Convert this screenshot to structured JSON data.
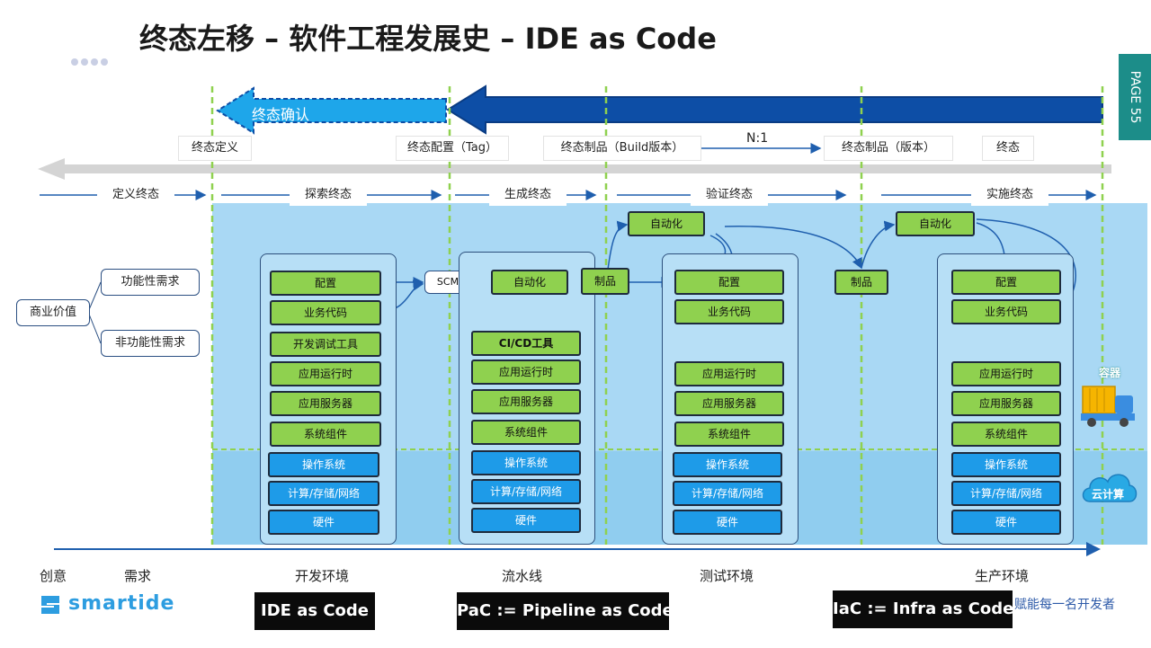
{
  "title": "终态左移 – 软件工程发展史 – IDE as Code",
  "page_tab": "PAGE 55",
  "top_arrow_label": "终态确认",
  "milestones": [
    "终态定义",
    "终态配置（Tag）",
    "终态制品（Build版本）",
    "终态制品（版本）",
    "终态"
  ],
  "ratio_label": "N:1",
  "stages": [
    "定义终态",
    "探索终态",
    "生成终态",
    "验证终态",
    "实施终态"
  ],
  "requirements": {
    "business": "商业价值",
    "functional": "功能性需求",
    "non_functional": "非功能性需求"
  },
  "dev_stack": [
    "配置",
    "业务代码",
    "开发调试工具",
    "应用运行时",
    "应用服务器",
    "系统组件",
    "操作系统",
    "计算/存储/网络",
    "硬件"
  ],
  "pipeline": {
    "scm": "SCM",
    "auto": "自动化",
    "artifact": "制品",
    "stack": [
      "CI/CD工具",
      "应用运行时",
      "应用服务器",
      "系统组件",
      "操作系统",
      "计算/存储/网络",
      "硬件"
    ]
  },
  "test": {
    "auto": "自动化",
    "stack": [
      "配置",
      "业务代码",
      "应用运行时",
      "应用服务器",
      "系统组件",
      "操作系统",
      "计算/存储/网络",
      "硬件"
    ]
  },
  "prod": {
    "artifact": "制品",
    "auto": "自动化",
    "stack": [
      "配置",
      "业务代码",
      "应用运行时",
      "应用服务器",
      "系统组件",
      "操作系统",
      "计算/存储/网络",
      "硬件"
    ]
  },
  "side_icons": {
    "container": "容器",
    "cloud": "云计算"
  },
  "bottom_labels": [
    "创意",
    "需求",
    "开发环境",
    "流水线",
    "测试环境",
    "生产环境"
  ],
  "bottom_boxes": [
    "IDE as Code",
    "PaC := Pipeline as Code",
    "IaC := Infra as Code"
  ],
  "logo": "smartide",
  "slogan": "赋能每一名开发者",
  "colors": {
    "green": "#8fd14f",
    "blue": "#1e9be8",
    "dark_blue": "#0d4ea6",
    "teal": "#1c8d89",
    "band": "#a9d8f4"
  }
}
